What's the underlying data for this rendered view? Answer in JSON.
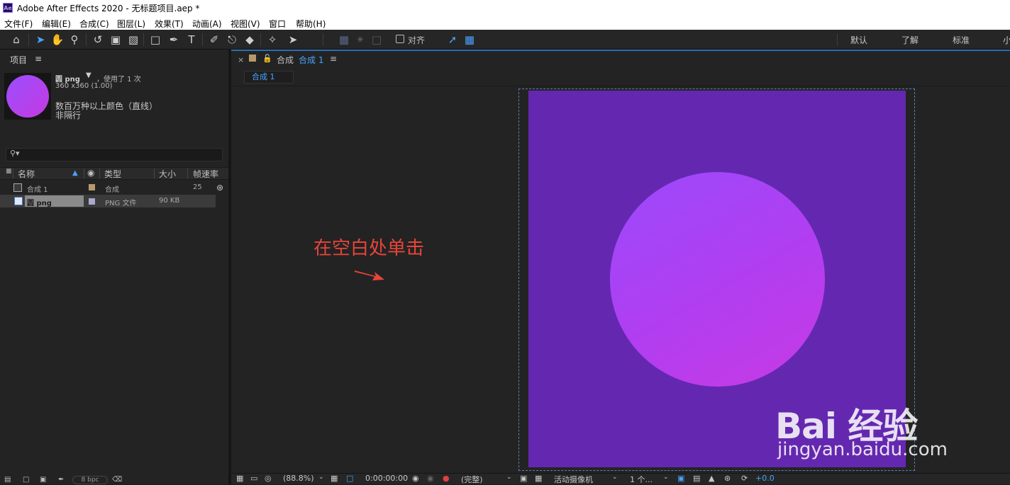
{
  "window": {
    "app_logo": "Ae",
    "title": "Adobe After Effects 2020 - 无标题项目.aep *"
  },
  "menu": [
    "文件(F)",
    "编辑(E)",
    "合成(C)",
    "图层(L)",
    "效果(T)",
    "动画(A)",
    "视图(V)",
    "窗口",
    "帮助(H)"
  ],
  "toolbar": {
    "tools": [
      "home-icon",
      "selection-icon",
      "hand-icon",
      "zoom-icon",
      "rotate-icon",
      "camera-icon",
      "pan-behind-icon",
      "rectangle-icon",
      "pen-icon",
      "text-icon",
      "brush-icon",
      "clone-stamp-icon",
      "eraser-icon",
      "roto-brush-icon",
      "puppet-pin-icon"
    ],
    "align_label": "对齐",
    "workspaces": [
      "默认",
      "了解",
      "标准",
      "小"
    ]
  },
  "project": {
    "tab_label": "项目",
    "selected_name": "圆 png",
    "usage": "，使用了 1 次",
    "dimensions": "360 x360 (1.00)",
    "color_info": "数百万种以上颜色（直线）",
    "interlace": "非隔行",
    "columns": {
      "name": "名称",
      "type": "类型",
      "size": "大小",
      "fps": "帧速率"
    },
    "items": [
      {
        "name": "合成 1",
        "type": "合成",
        "size": "",
        "fps": "25",
        "swatch": "#b89a6a",
        "icon": "composition-icon"
      },
      {
        "name": "圆 png",
        "type": "PNG 文件",
        "size": "90 KB",
        "fps": "",
        "swatch": "#a9a9d0",
        "icon": "png-file-icon"
      }
    ],
    "footer_bpc": "8 bpc"
  },
  "comp": {
    "close": "×",
    "tab_prefix": "合成",
    "tab_name": "合成 1",
    "subtab": "合成 1",
    "bg_color": "#6428b0"
  },
  "annotation": "在空白处单击",
  "viewer_footer": {
    "zoom": "(88.8%)",
    "timecode": "0:00:00:00",
    "resolution": "(完整)",
    "camera": "活动摄像机",
    "views": "1 个...",
    "exposure": "+0.0"
  },
  "watermark": {
    "logo": "Bai 经验",
    "url": "jingyan.baidu.com"
  }
}
